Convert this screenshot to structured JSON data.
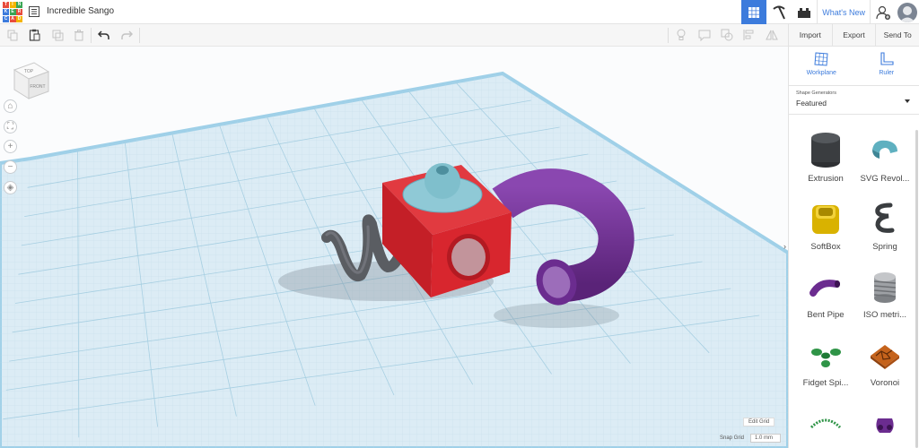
{
  "app": {
    "logo_letters": [
      "T",
      "I",
      "N",
      "K",
      "E",
      "R",
      "C",
      "A",
      "D"
    ],
    "logo_colors": [
      "#e84d3d",
      "#f4b400",
      "#3aa655",
      "#3c7bdc",
      "#3aa655",
      "#e84d3d",
      "#3c7bdc",
      "#e84d3d",
      "#f4b400"
    ],
    "design_title": "Incredible Sango",
    "whats_new": "What's New"
  },
  "actions": {
    "import": "Import",
    "export": "Export",
    "send_to": "Send To"
  },
  "panel_tools": {
    "workplane": "Workplane",
    "ruler": "Ruler"
  },
  "generators": {
    "caption": "Shape Generators",
    "selected": "Featured"
  },
  "shapes": [
    {
      "label": "Extrusion"
    },
    {
      "label": "SVG Revol..."
    },
    {
      "label": "SoftBox"
    },
    {
      "label": "Spring"
    },
    {
      "label": "Bent Pipe"
    },
    {
      "label": "ISO metri..."
    },
    {
      "label": "Fidget Spi..."
    },
    {
      "label": "Voronoi"
    },
    {
      "label": ""
    },
    {
      "label": ""
    }
  ],
  "viewcube": {
    "top": "TOP",
    "front": "FRONT"
  },
  "grid": {
    "edit_grid": "Edit Grid",
    "snap_grid": "Snap Grid",
    "snap_value": "1.0 mm"
  },
  "colors": {
    "accent": "#3c7bdc",
    "workplane": "#dcecf5",
    "box": "#d8262e",
    "pipe": "#6b2c8f",
    "spring": "#5a5d62",
    "sphere": "#7fbfcc"
  }
}
